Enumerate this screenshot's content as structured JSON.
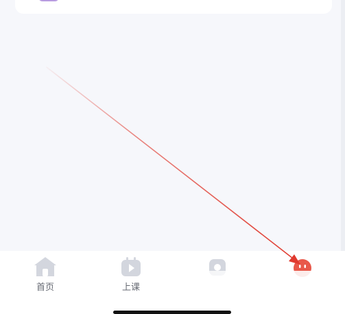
{
  "tabbar": {
    "items": [
      {
        "label": "首页",
        "icon": "home-icon"
      },
      {
        "label": "上课",
        "icon": "play-tv-icon"
      },
      {
        "label": "",
        "icon": "discover-icon"
      },
      {
        "label": "",
        "icon": "mine-face-icon"
      }
    ]
  },
  "colors": {
    "background": "#f6f7fb",
    "tab_icon": "#d3d6de",
    "tab_label": "#666a73",
    "active_icon": "#e8584a",
    "arrow": "#e03a2f"
  }
}
